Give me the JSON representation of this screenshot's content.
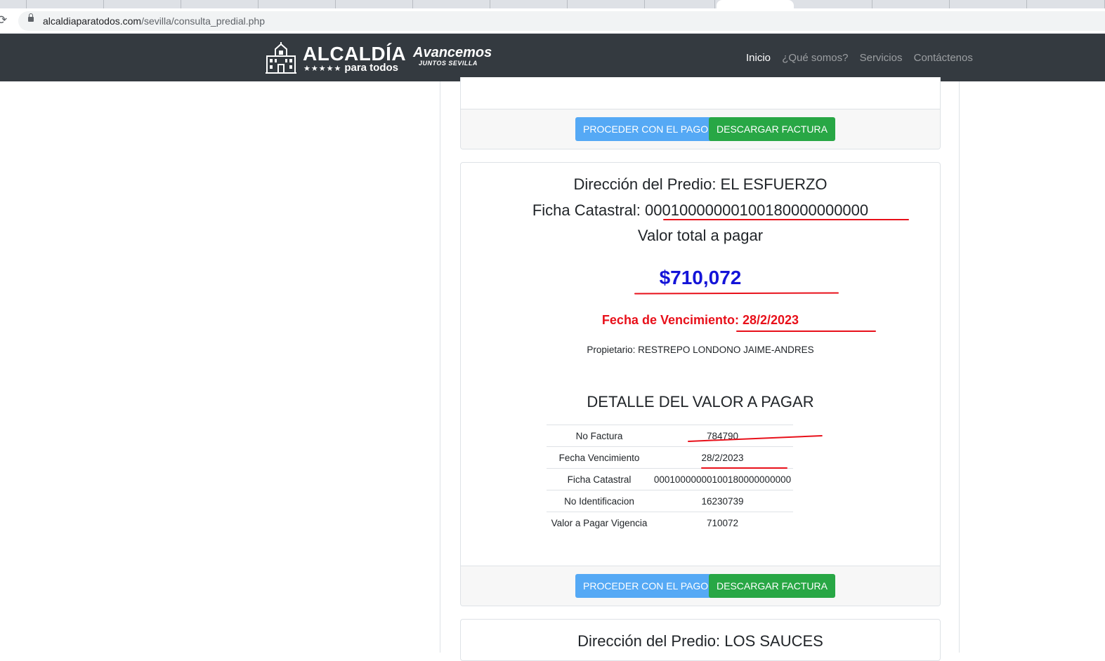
{
  "browser": {
    "url_host": "alcaldiaparatodos.com",
    "url_path": "/sevilla/consulta_predial.php"
  },
  "navbar": {
    "logo_title": "ALCALDÍA",
    "logo_stars": "★★★★★",
    "logo_subtitle": "para todos",
    "logo2_title": "Avancemos",
    "logo2_subtitle": "JUNTOS SEVILLA",
    "links": [
      "Inicio",
      "¿Qué somos?",
      "Servicios",
      "Contáctenos"
    ],
    "active_link": "Inicio"
  },
  "cards": [
    {
      "pay_button": "PROCEDER CON EL PAGO",
      "download_button": "DESCARGAR FACTURA"
    },
    {
      "address_line": "Dirección del Predio: EL ESFUERZO",
      "ficha_label": "Ficha Catastral: ",
      "ficha_value": "00010000000100180000000000",
      "total_label": "Valor total a pagar",
      "total_amount": "$710,072",
      "due_label": "Fecha de Vencimiento: ",
      "due_value": "28/2/2023",
      "owner": "Propietario: RESTREPO LONDONO JAIME-ANDRES",
      "detail_title": "DETALLE DEL VALOR A PAGAR",
      "detail_rows": [
        {
          "label": "No Factura",
          "value": "784790"
        },
        {
          "label": "Fecha Vencimiento",
          "value": "28/2/2023"
        },
        {
          "label": "Ficha Catastral",
          "value": "00010000000100180000000000"
        },
        {
          "label": "No Identificacion",
          "value": "16230739"
        },
        {
          "label": "Valor a Pagar Vigencia",
          "value": "710072"
        }
      ],
      "pay_button": "PROCEDER CON EL PAGO",
      "download_button": "DESCARGAR FACTURA"
    },
    {
      "address_line": "Dirección del Predio: LOS SAUCES"
    }
  ],
  "colors": {
    "navbar_bg": "#343a40",
    "pay_button": "#55a9f5",
    "download_button": "#28a745",
    "amount": "#1414d8",
    "due_date": "#e8101a"
  }
}
